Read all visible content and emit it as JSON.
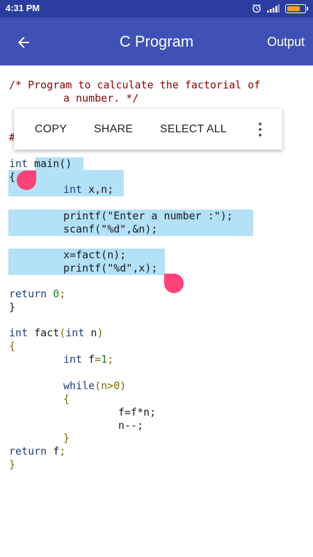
{
  "status_bar": {
    "time": "4:31 PM",
    "icons": [
      "alarm-icon",
      "signal-icon",
      "battery-icon"
    ],
    "battery_color": "#ff9a2e"
  },
  "app_bar": {
    "back_icon": "arrow-left-icon",
    "title": "C Program",
    "output_label": "Output",
    "color": "#3f51b5"
  },
  "context_menu": {
    "copy_label": "COPY",
    "share_label": "SHARE",
    "select_all_label": "SELECT ALL",
    "more_icon": "more-vert-icon"
  },
  "selection": {
    "highlight_color": "#b3e1f7",
    "handle_color": "#ff4277"
  },
  "code": {
    "comment_line1": "/* Program to calculate the factorial of",
    "comment_line2": "a number. */",
    "hidden_line_start": "#",
    "main_kw": "int",
    "main_sig": " main()",
    "open_brace_main": "{",
    "decl_kw": "int",
    "decl_rest": " x,n;",
    "printf1": "printf(\"Enter a number :\");",
    "scanf": "scanf(\"%d\",&n);",
    "assign": "x=fact(n);",
    "printf2": "printf(\"%d\",x);",
    "return_kw": "return",
    "return_num": "0",
    "return_end": ";",
    "close_brace_main": "}",
    "fact_kw": "int",
    "fact_name": " fact",
    "fact_paren_open": "(",
    "fact_param_kw": "int",
    "fact_param": " n",
    "fact_paren_close": ")",
    "open_brace_fact": "{",
    "f_kw": "int",
    "f_name": " f",
    "f_eq": "=",
    "f_num": "1",
    "f_semi": ";",
    "while_kw": "while",
    "while_cond": "(n>0)",
    "open_brace_while": "{",
    "mult_line": "f=f*n;",
    "decr_line": "n--;",
    "close_brace_while": "}",
    "return2_kw": "return",
    "return2_val": " f",
    "return2_semi": ";",
    "close_brace_fact": "}"
  }
}
